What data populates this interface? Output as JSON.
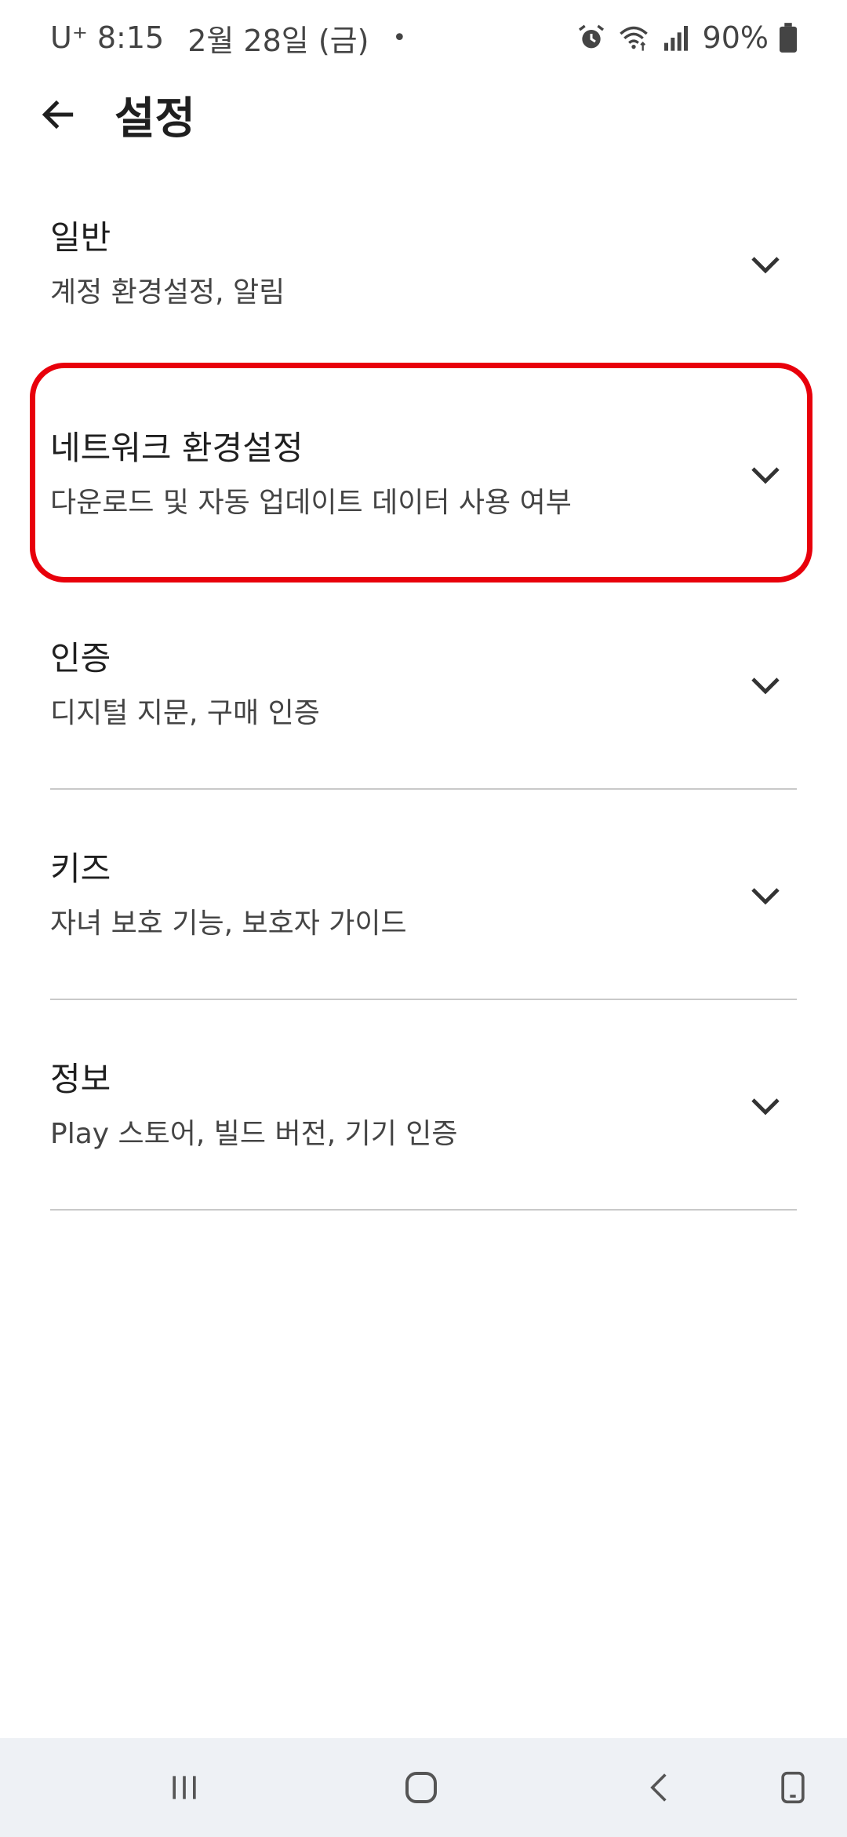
{
  "status_bar": {
    "carrier": "U⁺",
    "time": "8:15",
    "date": "2월 28일 (금)",
    "dot": "•",
    "battery": "90%",
    "icons": [
      "alarm-icon",
      "wifi-icon",
      "signal-icon",
      "battery-icon"
    ]
  },
  "app_bar": {
    "title": "설정",
    "back_icon": "arrow-back-icon"
  },
  "sections": [
    {
      "title": "일반",
      "subtitle": "계정 환경설정, 알림"
    },
    {
      "title": "네트워크 환경설정",
      "subtitle": "다운로드 및 자동 업데이트 데이터 사용 여부"
    },
    {
      "title": "인증",
      "subtitle": "디지털 지문, 구매 인증"
    },
    {
      "title": "키즈",
      "subtitle": "자녀 보호 기능, 보호자 가이드"
    },
    {
      "title": "정보",
      "subtitle": "Play 스토어, 빌드 버전, 기기 인증"
    }
  ],
  "highlight_color": "#e8000b",
  "nav_bar": {
    "buttons": [
      "recent-apps-icon",
      "home-icon",
      "back-icon",
      "rotate-icon"
    ]
  }
}
